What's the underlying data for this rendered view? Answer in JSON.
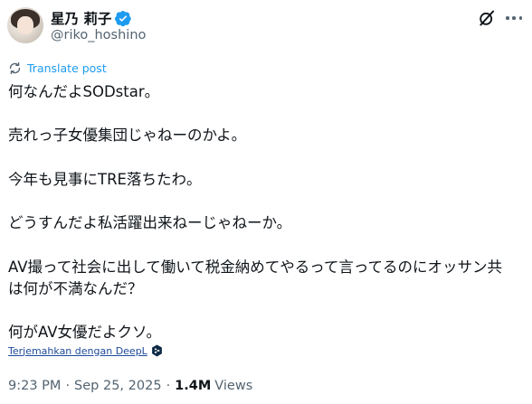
{
  "author": {
    "display_name": "星乃 莉子",
    "handle": "@riko_hoshino",
    "verified": true
  },
  "icons": {
    "grok": "grok-icon",
    "more": "more-options-icon",
    "translate": "translate-icon",
    "deepl": "deepl-icon",
    "verified": "verified-badge-icon"
  },
  "translate_label": "Translate post",
  "tweet_lines": [
    "何なんだよSODstar。",
    "",
    "売れっ子女優集団じゃねーのかよ。",
    "",
    "今年も見事にTRE落ちたわ。",
    "",
    "どうすんだよ私活躍出来ねーじゃねーか。",
    "",
    "AV撮って社会に出して働いて税金納めてやるって言ってるのにオッサン共",
    "は何が不満なんだ？",
    "",
    "何がAV女優だよクソ。"
  ],
  "deepl_label": "Terjemahkan dengan DeepL",
  "meta": {
    "time": "9:23 PM",
    "separator": "·",
    "date": "Sep 25, 2025",
    "views_count": "1.4M",
    "views_label": "Views"
  },
  "colors": {
    "accent": "#1d9bf0",
    "text_primary": "#0f1419",
    "text_secondary": "#536471",
    "deepl_link": "#1d4a9b"
  }
}
